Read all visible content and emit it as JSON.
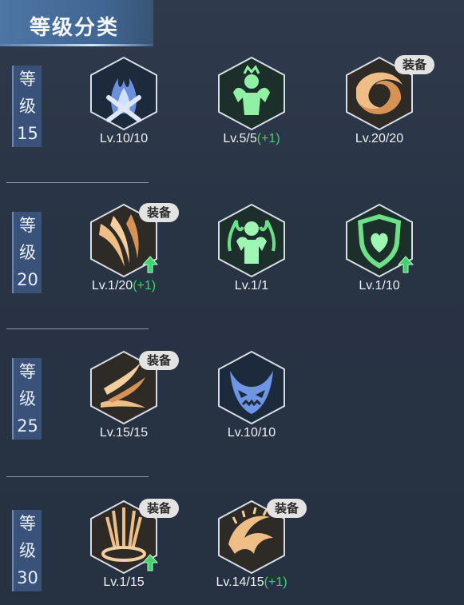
{
  "title": "等级分类",
  "equip_badge": "装备",
  "colors": {
    "plus": "#3fd46a",
    "label_bg": "#3a5279",
    "title_bg": "#4e76a4"
  },
  "tiers": [
    {
      "chars": [
        "等",
        "级",
        "15"
      ],
      "skills": [
        {
          "icon": "blue-flame-cross-icon",
          "level": "Lv.10/10",
          "bonus": "",
          "equipped": false,
          "upgrade": false
        },
        {
          "icon": "green-flexing-warrior-icon",
          "level": "Lv.5/5",
          "bonus": "(+1)",
          "equipped": false,
          "upgrade": false
        },
        {
          "icon": "orange-vortex-icon",
          "level": "Lv.20/20",
          "bonus": "",
          "equipped": true,
          "upgrade": false
        }
      ]
    },
    {
      "chars": [
        "等",
        "级",
        "20"
      ],
      "skills": [
        {
          "icon": "orange-slash-icon",
          "level": "Lv.1/20",
          "bonus": "(+1)",
          "equipped": true,
          "upgrade": true
        },
        {
          "icon": "green-flame-warrior-icon",
          "level": "Lv.1/1",
          "bonus": "",
          "equipped": false,
          "upgrade": false
        },
        {
          "icon": "green-heart-shield-icon",
          "level": "Lv.1/10",
          "bonus": "",
          "equipped": false,
          "upgrade": true
        }
      ]
    },
    {
      "chars": [
        "等",
        "级",
        "25"
      ],
      "skills": [
        {
          "icon": "orange-fire-streaks-icon",
          "level": "Lv.15/15",
          "bonus": "",
          "equipped": true,
          "upgrade": false
        },
        {
          "icon": "blue-demon-mask-icon",
          "level": "Lv.10/10",
          "bonus": "",
          "equipped": false,
          "upgrade": false
        }
      ]
    },
    {
      "chars": [
        "等",
        "级",
        "30"
      ],
      "skills": [
        {
          "icon": "orange-pillar-burst-icon",
          "level": "Lv.1/15",
          "bonus": "",
          "equipped": true,
          "upgrade": true
        },
        {
          "icon": "orange-beast-claw-icon",
          "level": "Lv.14/15",
          "bonus": "(+1)",
          "equipped": true,
          "upgrade": false
        }
      ]
    }
  ]
}
